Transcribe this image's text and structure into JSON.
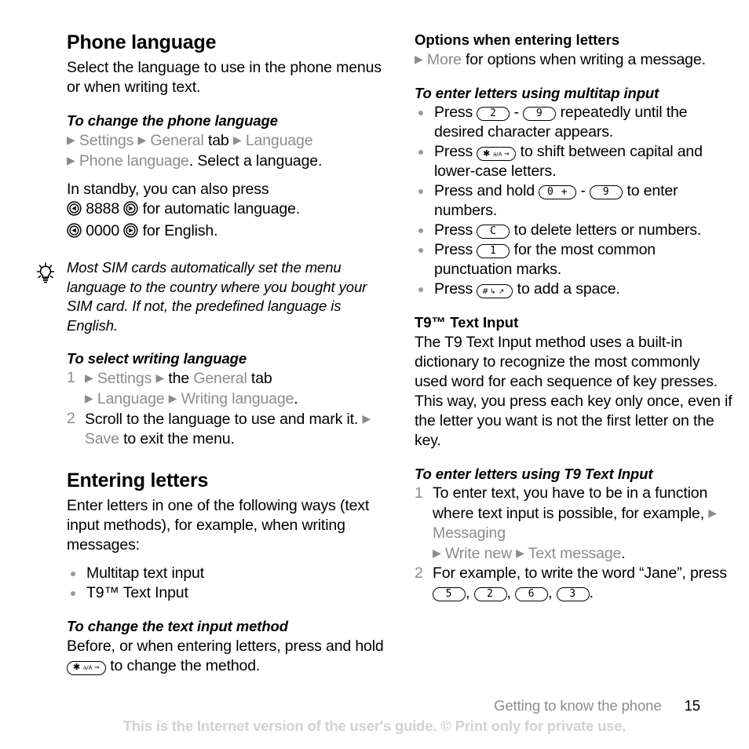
{
  "left": {
    "heading": "Phone language",
    "intro": "Select the language to use in the phone menus or when writing text.",
    "change_lang": {
      "title": "To change the phone language",
      "path1_a": "Settings",
      "path1_b": "General",
      "path1_tab": "tab",
      "path1_c": "Language",
      "path2_a": "Phone language",
      "path2_tail": ". Select a language."
    },
    "standby": {
      "line1": "In standby, you can also press",
      "row1_num": "8888",
      "row1_tail": "for automatic language.",
      "row2_num": "0000",
      "row2_tail": "for English."
    },
    "tip": "Most SIM cards automatically set the menu language to the country where you bought your SIM card. If not, the predefined language is English.",
    "writing_lang": {
      "title": "To select writing language",
      "step1_n": "1",
      "step1_a": "Settings",
      "step1_the": "the",
      "step1_b": "General",
      "step1_tab": "tab",
      "step1_c": "Language",
      "step1_d": "Writing language",
      "step1_dot": ".",
      "step2_n": "2",
      "step2_a": "Scroll to the language to use and mark it.",
      "step2_b": "Save",
      "step2_c": "to exit the menu."
    },
    "entering": {
      "heading": "Entering letters",
      "intro": "Enter letters in one of the following ways (text input methods), for example, when writing messages:",
      "methods": [
        "Multitap text input",
        "T9™ Text Input"
      ]
    },
    "change_method": {
      "title": "To change the text input method",
      "text_a": "Before, or when entering letters, press and hold",
      "text_b": "to change the method."
    }
  },
  "right": {
    "options": {
      "title": "Options when entering letters",
      "more": "More",
      "tail": "for options when writing a message."
    },
    "multitap": {
      "title": "To enter letters using multitap input",
      "items": [
        {
          "pre": "Press",
          "keys": [
            "2",
            "9"
          ],
          "sep": "-",
          "post": "repeatedly until the desired character appears."
        },
        {
          "pre": "Press",
          "keys": [
            "star"
          ],
          "sep": "",
          "post": "to shift between capital and lower-case letters."
        },
        {
          "pre": "Press and hold",
          "keys": [
            "0 +",
            "9"
          ],
          "sep": "-",
          "post": "to enter numbers."
        },
        {
          "pre": "Press",
          "keys": [
            "C"
          ],
          "sep": "",
          "post": "to delete letters or numbers."
        },
        {
          "pre": "Press",
          "keys": [
            "1"
          ],
          "sep": "",
          "post": "for the most common punctuation marks."
        },
        {
          "pre": "Press",
          "keys": [
            "hash"
          ],
          "sep": "",
          "post": "to add a space."
        }
      ]
    },
    "t9": {
      "heading": "T9™ Text Input",
      "body": "The T9 Text Input method uses a built-in dictionary to recognize the most commonly used word for each sequence of key presses. This way, you press each key only once, even if the letter you want is not the first letter on the key."
    },
    "t9_steps": {
      "title": "To enter letters using T9 Text Input",
      "step1_n": "1",
      "step1_a": "To enter text, you have to be in a function where text input is possible, for example,",
      "step1_b": "Messaging",
      "step1_c": "Write new",
      "step1_d": "Text message",
      "step1_dot": ".",
      "step2_n": "2",
      "step2_a": "For example, to write the word “Jane”, press",
      "step2_keys": [
        "5",
        "2",
        "6",
        "3"
      ],
      "step2_end": "."
    }
  },
  "footer": {
    "section": "Getting to know the phone",
    "page": "15",
    "watermark": "This is the Internet version of the user's guide. © Print only for private use."
  },
  "colors": {
    "menu_gray": "#8c8c8c",
    "watermark_gray": "#d2d2d2",
    "text_black": "#000000"
  }
}
